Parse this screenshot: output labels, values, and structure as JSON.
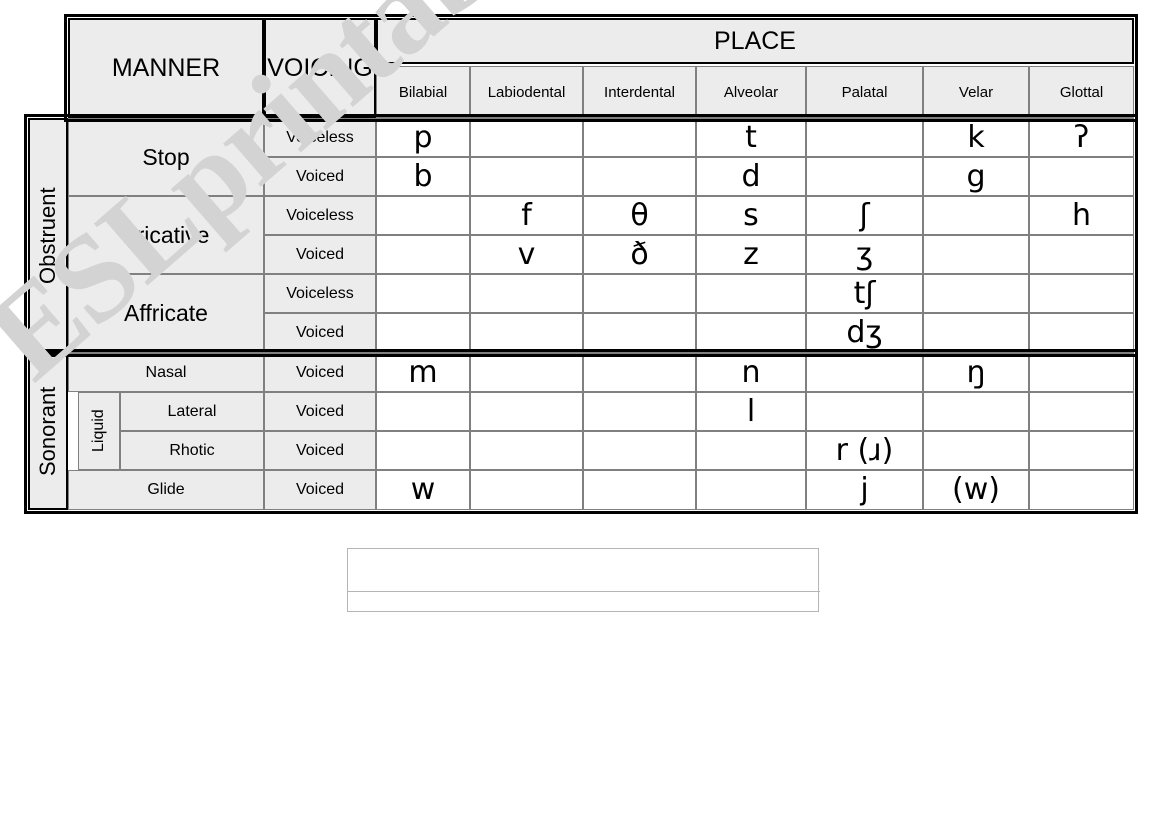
{
  "watermark": {
    "text": "ESLprintables.com"
  },
  "table": {
    "corner_headers": {
      "manner": "MANNER",
      "voicing": "VOICING",
      "place": "PLACE"
    },
    "place_columns": [
      "Bilabial",
      "Labiodental",
      "Interdental",
      "Alveolar",
      "Palatal",
      "Velar",
      "Glottal"
    ],
    "groups": [
      {
        "name": "Obstruent"
      },
      {
        "name": "Sonorant"
      }
    ],
    "liquid_label": "Liquid",
    "manners": [
      {
        "label": "Stop",
        "group": "Obstruent"
      },
      {
        "label": "Fricative",
        "group": "Obstruent"
      },
      {
        "label": "Affricate",
        "group": "Obstruent"
      },
      {
        "label": "Nasal",
        "group": "Sonorant"
      },
      {
        "label": "Lateral",
        "group": "Sonorant"
      },
      {
        "label": "Rhotic",
        "group": "Sonorant"
      },
      {
        "label": "Glide",
        "group": "Sonorant"
      }
    ],
    "rows": [
      {
        "manner": "Stop",
        "voicing": "Voiceless",
        "cells": [
          "p",
          "",
          "",
          "t",
          "",
          "k",
          "ʔ"
        ]
      },
      {
        "manner": "Stop",
        "voicing": "Voiced",
        "cells": [
          "b",
          "",
          "",
          "d",
          "",
          "g",
          ""
        ]
      },
      {
        "manner": "Fricative",
        "voicing": "Voiceless",
        "cells": [
          "",
          "f",
          "θ",
          "s",
          "ʃ",
          "",
          "h"
        ]
      },
      {
        "manner": "Fricative",
        "voicing": "Voiced",
        "cells": [
          "",
          "v",
          "ð",
          "z",
          "ʒ",
          "",
          ""
        ]
      },
      {
        "manner": "Affricate",
        "voicing": "Voiceless",
        "cells": [
          "",
          "",
          "",
          "",
          "tʃ",
          "",
          ""
        ]
      },
      {
        "manner": "Affricate",
        "voicing": "Voiced",
        "cells": [
          "",
          "",
          "",
          "",
          "dʒ",
          "",
          ""
        ]
      },
      {
        "manner": "Nasal",
        "voicing": "Voiced",
        "cells": [
          "m",
          "",
          "",
          "n",
          "",
          "ŋ",
          ""
        ]
      },
      {
        "manner": "Lateral",
        "voicing": "Voiced",
        "cells": [
          "",
          "",
          "",
          "l",
          "",
          "",
          ""
        ]
      },
      {
        "manner": "Rhotic",
        "voicing": "Voiced",
        "cells": [
          "",
          "",
          "",
          "",
          "r (ɹ)",
          "",
          ""
        ]
      },
      {
        "manner": "Glide",
        "voicing": "Voiced",
        "cells": [
          "w",
          "",
          "",
          "",
          "j",
          "(w)",
          ""
        ]
      }
    ]
  },
  "notes_box": {
    "line_1": "",
    "line_2": ""
  }
}
